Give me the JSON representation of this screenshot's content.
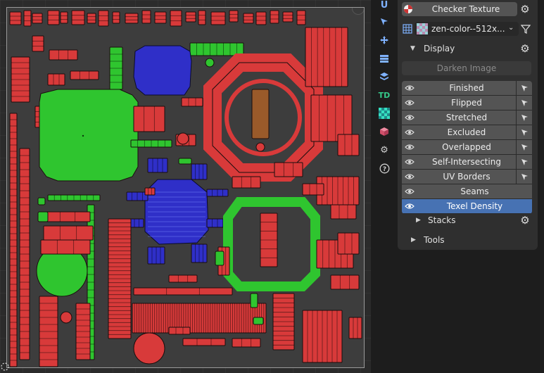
{
  "viewport": {
    "accent": {
      "red": "#d83a3a",
      "green": "#2fc52f",
      "blue": "#2f2fc8",
      "brown": "#9a5a2a"
    }
  },
  "toolbar": {
    "icons": [
      "u-icon",
      "cursor-icon",
      "move-icon",
      "grid-icon",
      "layers-icon",
      "td-icon",
      "checker-icon",
      "cube-icon",
      "gear-icon",
      "help-icon"
    ],
    "u_glyph": "U",
    "td_glyph": "TD",
    "help_glyph": "?"
  },
  "panel": {
    "checker_label": "Checker Texture",
    "texture_name": "zen-color--512x...",
    "display_label": "Display",
    "darken_label": "Darken Image",
    "overlays": [
      {
        "label": "Finished",
        "selectable": true,
        "active": false
      },
      {
        "label": "Flipped",
        "selectable": true,
        "active": false
      },
      {
        "label": "Stretched",
        "selectable": true,
        "active": false
      },
      {
        "label": "Excluded",
        "selectable": true,
        "active": false
      },
      {
        "label": "Overlapped",
        "selectable": true,
        "active": false
      },
      {
        "label": "Self-Intersecting",
        "selectable": true,
        "active": false
      },
      {
        "label": "UV Borders",
        "selectable": true,
        "active": false
      },
      {
        "label": "Seams",
        "selectable": false,
        "active": false
      },
      {
        "label": "Texel Density",
        "selectable": false,
        "active": true
      }
    ],
    "stacks_label": "Stacks",
    "tools_label": "Tools",
    "active_color": "#4772b3"
  }
}
